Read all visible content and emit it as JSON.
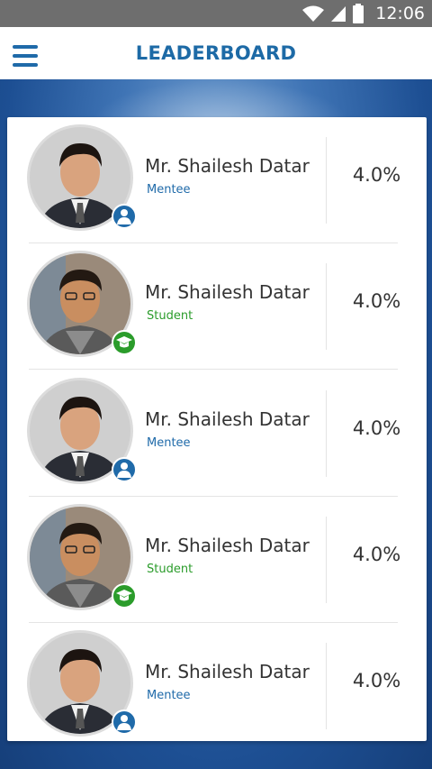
{
  "status_bar": {
    "time": "12:06"
  },
  "app_bar": {
    "title": "LEADERBOARD"
  },
  "leaderboard": [
    {
      "name": "Mr. Shailesh Datar",
      "role": "Mentee",
      "score": "4.0%"
    },
    {
      "name": "Mr. Shailesh Datar",
      "role": "Student",
      "score": "4.0%"
    },
    {
      "name": "Mr. Shailesh Datar",
      "role": "Mentee",
      "score": "4.0%"
    },
    {
      "name": "Mr. Shailesh Datar",
      "role": "Student",
      "score": "4.0%"
    },
    {
      "name": "Mr. Shailesh Datar",
      "role": "Mentee",
      "score": "4.0%"
    }
  ],
  "colors": {
    "primary": "#1f6aa9",
    "student": "#2b9c2b",
    "status_bar": "#6e6e6e"
  },
  "icons": {
    "menu": "hamburger-menu-icon",
    "mentee_badge": "mentee-icon",
    "student_badge": "graduation-cap-icon"
  }
}
